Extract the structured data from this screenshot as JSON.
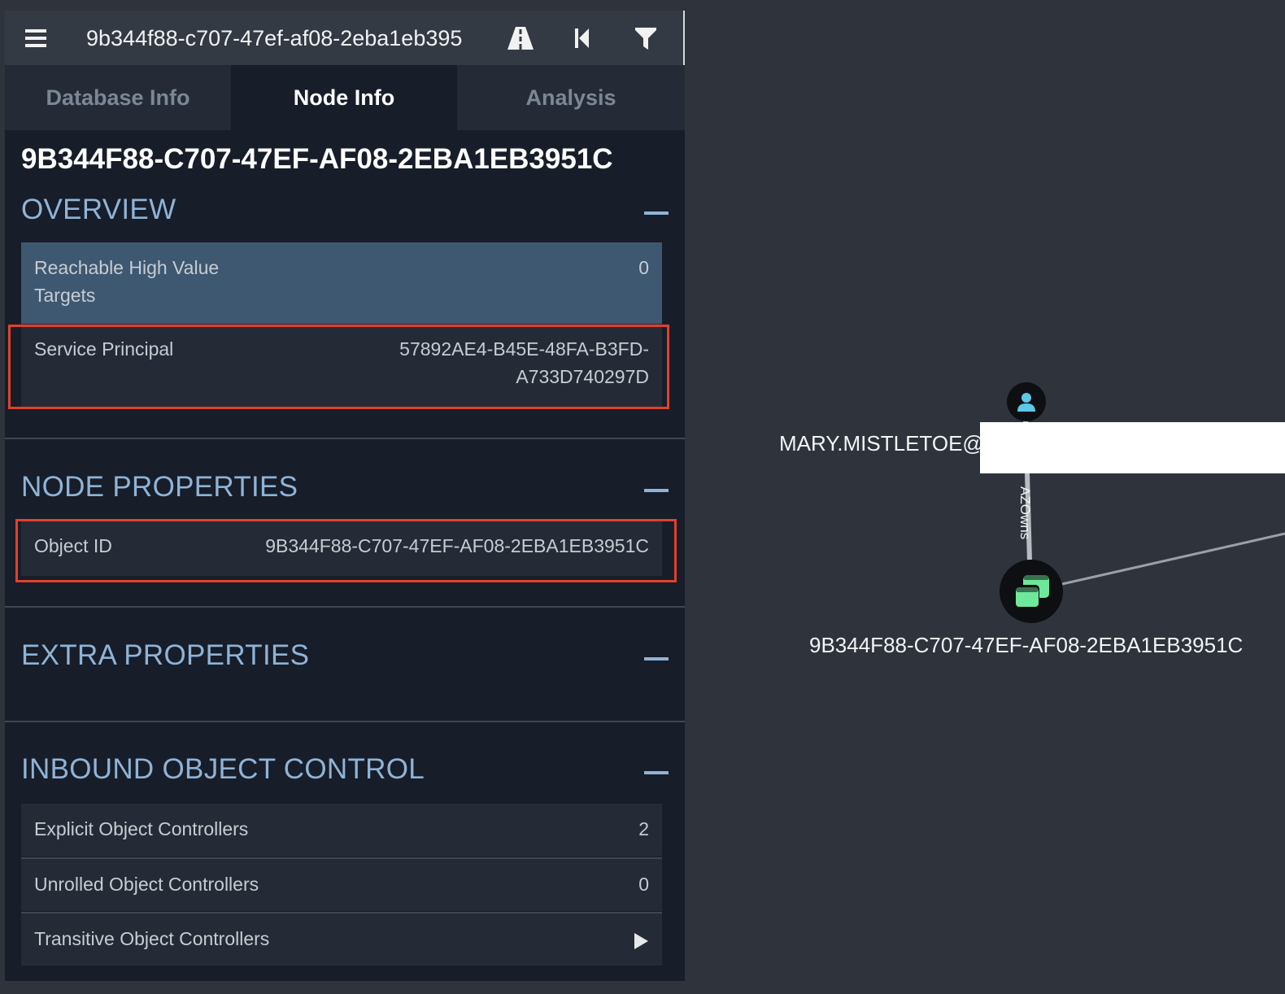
{
  "search": {
    "value": "9b344f88-c707-47ef-af08-2eba1eb395"
  },
  "tabs": [
    {
      "label": "Database Info",
      "active": false
    },
    {
      "label": "Node Info",
      "active": true
    },
    {
      "label": "Analysis",
      "active": false
    }
  ],
  "node": {
    "title": "9B344F88-C707-47EF-AF08-2EBA1EB3951C"
  },
  "overview": {
    "title": "OVERVIEW",
    "rows": [
      {
        "label_line1": "Reachable High Value",
        "label_line2": "Targets",
        "value": "0"
      },
      {
        "label": "Service Principal",
        "value_line1": "57892AE4-B45E-48FA-B3FD-",
        "value_line2": "A733D740297D"
      }
    ]
  },
  "node_properties": {
    "title": "NODE PROPERTIES",
    "rows": [
      {
        "label": "Object ID",
        "value": "9B344F88-C707-47EF-AF08-2EBA1EB3951C"
      }
    ]
  },
  "extra_properties": {
    "title": "EXTRA PROPERTIES"
  },
  "inbound": {
    "title": "INBOUND OBJECT CONTROL",
    "rows": [
      {
        "label": "Explicit Object Controllers",
        "value": "2"
      },
      {
        "label": "Unrolled Object Controllers",
        "value": "0"
      },
      {
        "label": "Transitive Object Controllers"
      }
    ]
  },
  "graph": {
    "user_node_label": "MARY.MISTLETOE@",
    "edge_label": "AZOwns",
    "app_node_label": "9B344F88-C707-47EF-AF08-2EBA1EB3951C"
  },
  "colors": {
    "accent": "#8fb3d6",
    "highlight": "#e0412c",
    "user_icon": "#5bc8e8",
    "app_icon": "#6ee89a"
  },
  "icons": {
    "menu": "hamburger-icon",
    "pathfinding": "road-icon",
    "back": "skip-back-icon",
    "filter": "filter-icon",
    "user": "user-icon",
    "app": "app-icon",
    "expand": "play-icon"
  }
}
